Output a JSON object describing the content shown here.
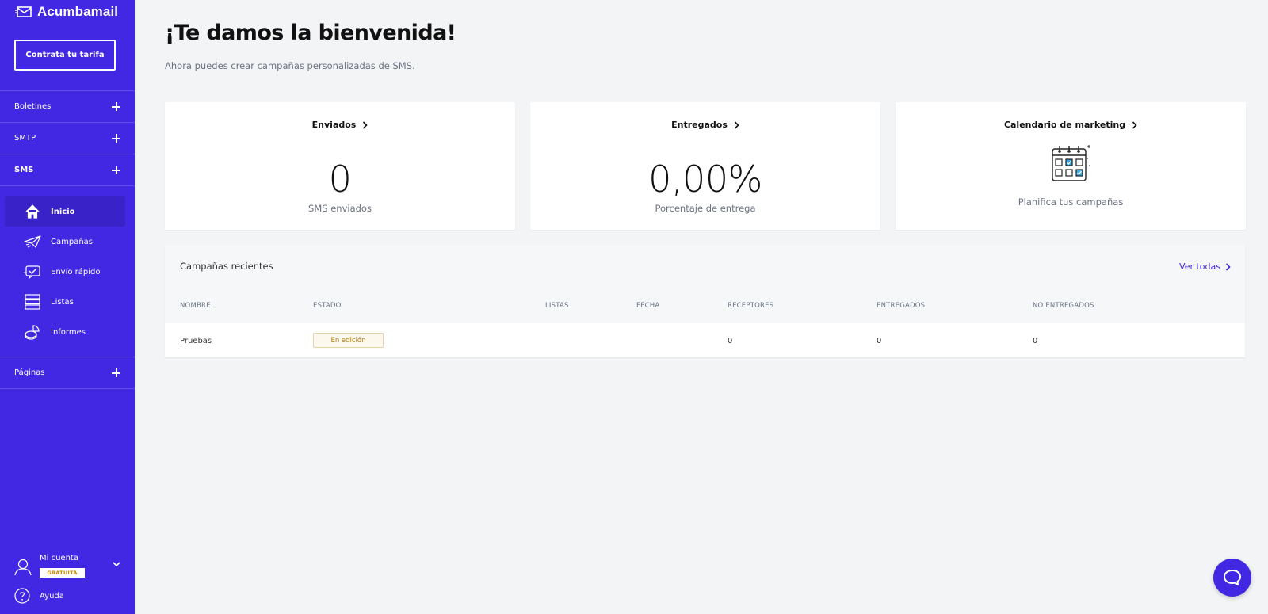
{
  "brand": {
    "name": "Acumbamail",
    "accent": "#4328e3"
  },
  "sidebar": {
    "plan_button": "Contrata tu tarifa",
    "sections": [
      {
        "label": "Boletines"
      },
      {
        "label": "SMTP"
      },
      {
        "label": "SMS"
      }
    ],
    "sms_items": [
      {
        "label": "Inicio",
        "icon": "home-icon",
        "active": true
      },
      {
        "label": "Campañas",
        "icon": "paper-plane-icon"
      },
      {
        "label": "Envío rápido",
        "icon": "quick-send-icon"
      },
      {
        "label": "Listas",
        "icon": "list-icon"
      },
      {
        "label": "Informes",
        "icon": "report-icon"
      }
    ],
    "pages_section": {
      "label": "Páginas"
    },
    "account": {
      "label": "Mi cuenta",
      "badge": "GRATUITA"
    },
    "help": {
      "label": "Ayuda"
    }
  },
  "main": {
    "title": "¡Te damos la bienvenida!",
    "subtitle": "Ahora puedes crear campañas personalizadas de SMS.",
    "cards": [
      {
        "title": "Enviados",
        "value": "0",
        "caption": "SMS enviados"
      },
      {
        "title": "Entregados",
        "value": "0,00%",
        "caption": "Porcentaje de entrega"
      },
      {
        "title": "Calendario de marketing",
        "caption": "Planifica tus campañas",
        "icon": "calendar-icon"
      }
    ],
    "recent": {
      "title": "Campañas recientes",
      "see_all": "Ver todas",
      "columns": [
        "NOMBRE",
        "ESTADO",
        "LISTAS",
        "FECHA",
        "RECEPTORES",
        "ENTREGADOS",
        "NO ENTREGADOS"
      ],
      "rows": [
        {
          "name": "Pruebas",
          "status": "En edición",
          "lists": "",
          "date": "",
          "receivers": "0",
          "delivered": "0",
          "not_delivered": "0"
        }
      ]
    }
  },
  "chat": {
    "icon": "chat-icon"
  }
}
